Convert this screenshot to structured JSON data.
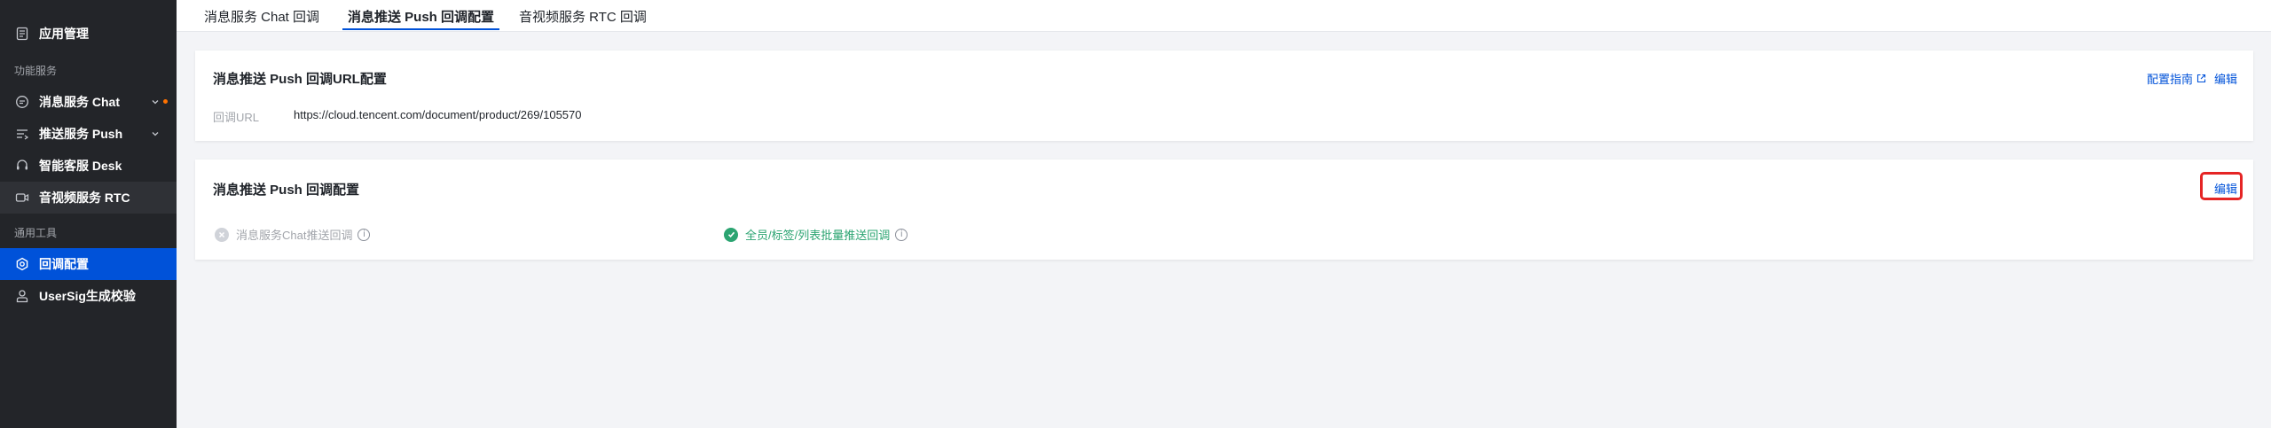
{
  "sidebar": {
    "items": [
      {
        "label": "应用管理",
        "icon": "app-manage-icon"
      },
      {
        "label": "消息服务 Chat",
        "icon": "chat-icon",
        "has_chevron": true,
        "has_dot": true
      },
      {
        "label": "推送服务 Push",
        "icon": "push-icon",
        "has_chevron": true
      },
      {
        "label": "智能客服 Desk",
        "icon": "desk-icon"
      },
      {
        "label": "音视频服务 RTC",
        "icon": "rtc-icon"
      },
      {
        "label": "回调配置",
        "icon": "gear-icon"
      },
      {
        "label": "UserSig生成校验",
        "icon": "usersig-icon"
      }
    ],
    "sections": [
      "功能服务",
      "通用工具"
    ]
  },
  "tabs": [
    {
      "label": "消息服务 Chat 回调"
    },
    {
      "label": "消息推送 Push 回调配置"
    },
    {
      "label": "音视频服务 RTC 回调"
    }
  ],
  "url_card": {
    "title": "消息推送 Push 回调URL配置",
    "guide_label": "配置指南",
    "edit_label": "编辑",
    "field_label": "回调URL",
    "field_value": "https://cloud.tencent.com/document/product/269/105570"
  },
  "config_card": {
    "title": "消息推送 Push 回调配置",
    "edit_label": "编辑",
    "options": [
      {
        "label": "消息服务Chat推送回调",
        "enabled": false
      },
      {
        "label": "全员/标签/列表批量推送回调",
        "enabled": true
      }
    ]
  },
  "colors": {
    "accent": "#0052d9",
    "success": "#2ba471",
    "sidebar_bg": "#232529",
    "highlight": "#e52525",
    "dot": "#ff7200"
  }
}
